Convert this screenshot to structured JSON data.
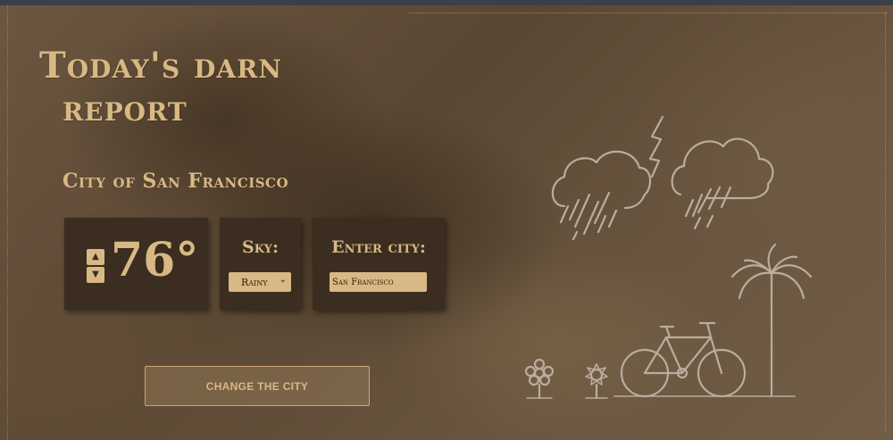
{
  "header": {
    "title_line1": "Today's darn",
    "title_line2": "report",
    "city_label": "City of San Francisco"
  },
  "temperature": {
    "value": "76°",
    "up_icon": "arrow-up-icon",
    "down_icon": "arrow-down-icon"
  },
  "sky": {
    "heading": "Sky:",
    "selected": "Rainy"
  },
  "city_input": {
    "heading": "Enter city:",
    "value": "San Francisco"
  },
  "actions": {
    "change_city_label": "Change the city"
  },
  "illustration": {
    "icons": [
      "rain-cloud-icon",
      "lightning-icon",
      "palm-tree-icon",
      "bicycle-icon",
      "flower-icon"
    ]
  },
  "colors": {
    "accent": "#d8b884",
    "card_bg": "#3b2d20",
    "line_art": "#b9ada0"
  }
}
